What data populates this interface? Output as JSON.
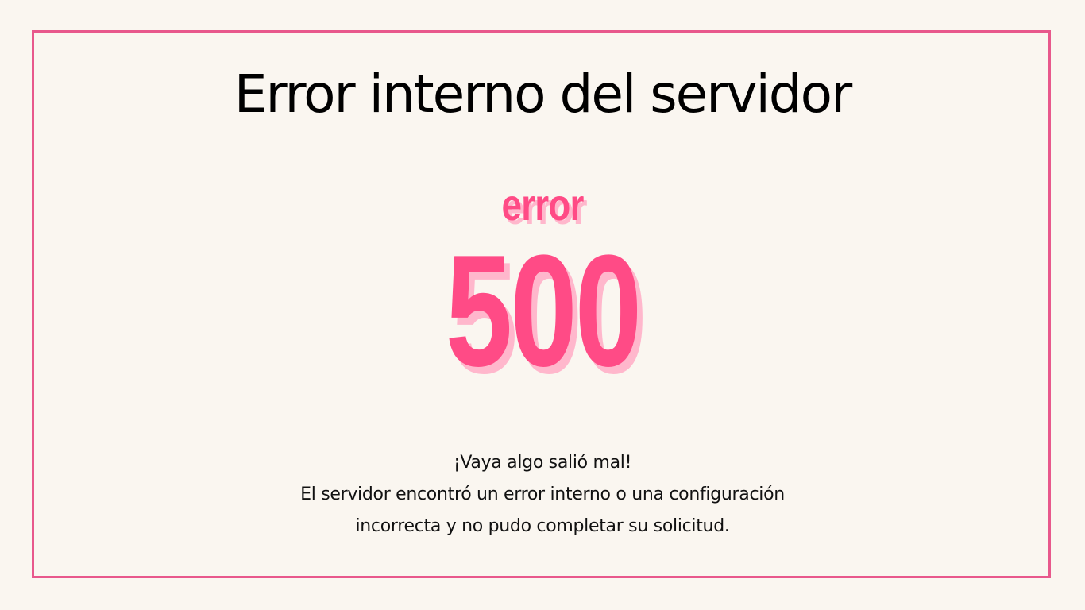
{
  "page": {
    "title": "Error interno del servidor",
    "error_word": "error",
    "error_code": "500",
    "message_lines": [
      "¡Vaya algo salió mal!",
      "El servidor encontró un error interno o una configuración",
      "incorrecta y no pudo completar su solicitud."
    ]
  },
  "colors": {
    "background": "#faf6f0",
    "frame_border": "#e8588c",
    "accent": "#ff4b86",
    "accent_shadow": "#ffb7cc",
    "text": "#000000"
  }
}
